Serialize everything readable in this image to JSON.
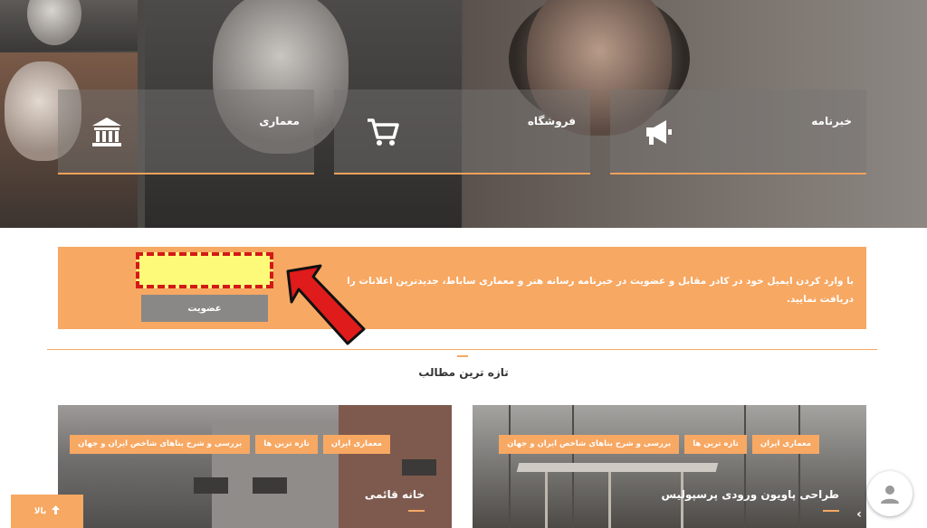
{
  "menu_tiles": [
    {
      "label": "خبرنامه",
      "icon": "megaphone-icon"
    },
    {
      "label": "فروشگاه",
      "icon": "cart-icon"
    },
    {
      "label": "معماری",
      "icon": "building-icon"
    }
  ],
  "newsletter": {
    "text": "با وارد کردن ایمیل خود در کادر مقابل و عضویت در خبرنامه رسانه هنر و معماری ساباط، جدیدترین اعلانات را دریافت نمایید.",
    "email_value": "",
    "button_label": "عضویت",
    "annotation": "red-arrow-pointing-to-email-field"
  },
  "latest": {
    "title": "تازه ترین مطالب",
    "cards": [
      {
        "title": "طراحی پاویون ورودی پرسپولیس",
        "tags": [
          "معماری ایران",
          "تازه ترین ها",
          "بررسی و شرح بناهای شاخص ایران و جهان"
        ]
      },
      {
        "title": "خانه قائمی",
        "tags": [
          "معماری ایران",
          "تازه ترین ها",
          "بررسی و شرح بناهای شاخص ایران و جهان"
        ]
      }
    ]
  },
  "back_to_top": {
    "label": "بالا",
    "icon": "arrow-up-icon"
  },
  "chat_widget": {
    "icon": "user-avatar-icon"
  },
  "colors": {
    "accent": "#f7a863",
    "button_gray": "#8a8886",
    "highlight_red": "#d41818",
    "email_yellow": "#fdfa7a"
  }
}
